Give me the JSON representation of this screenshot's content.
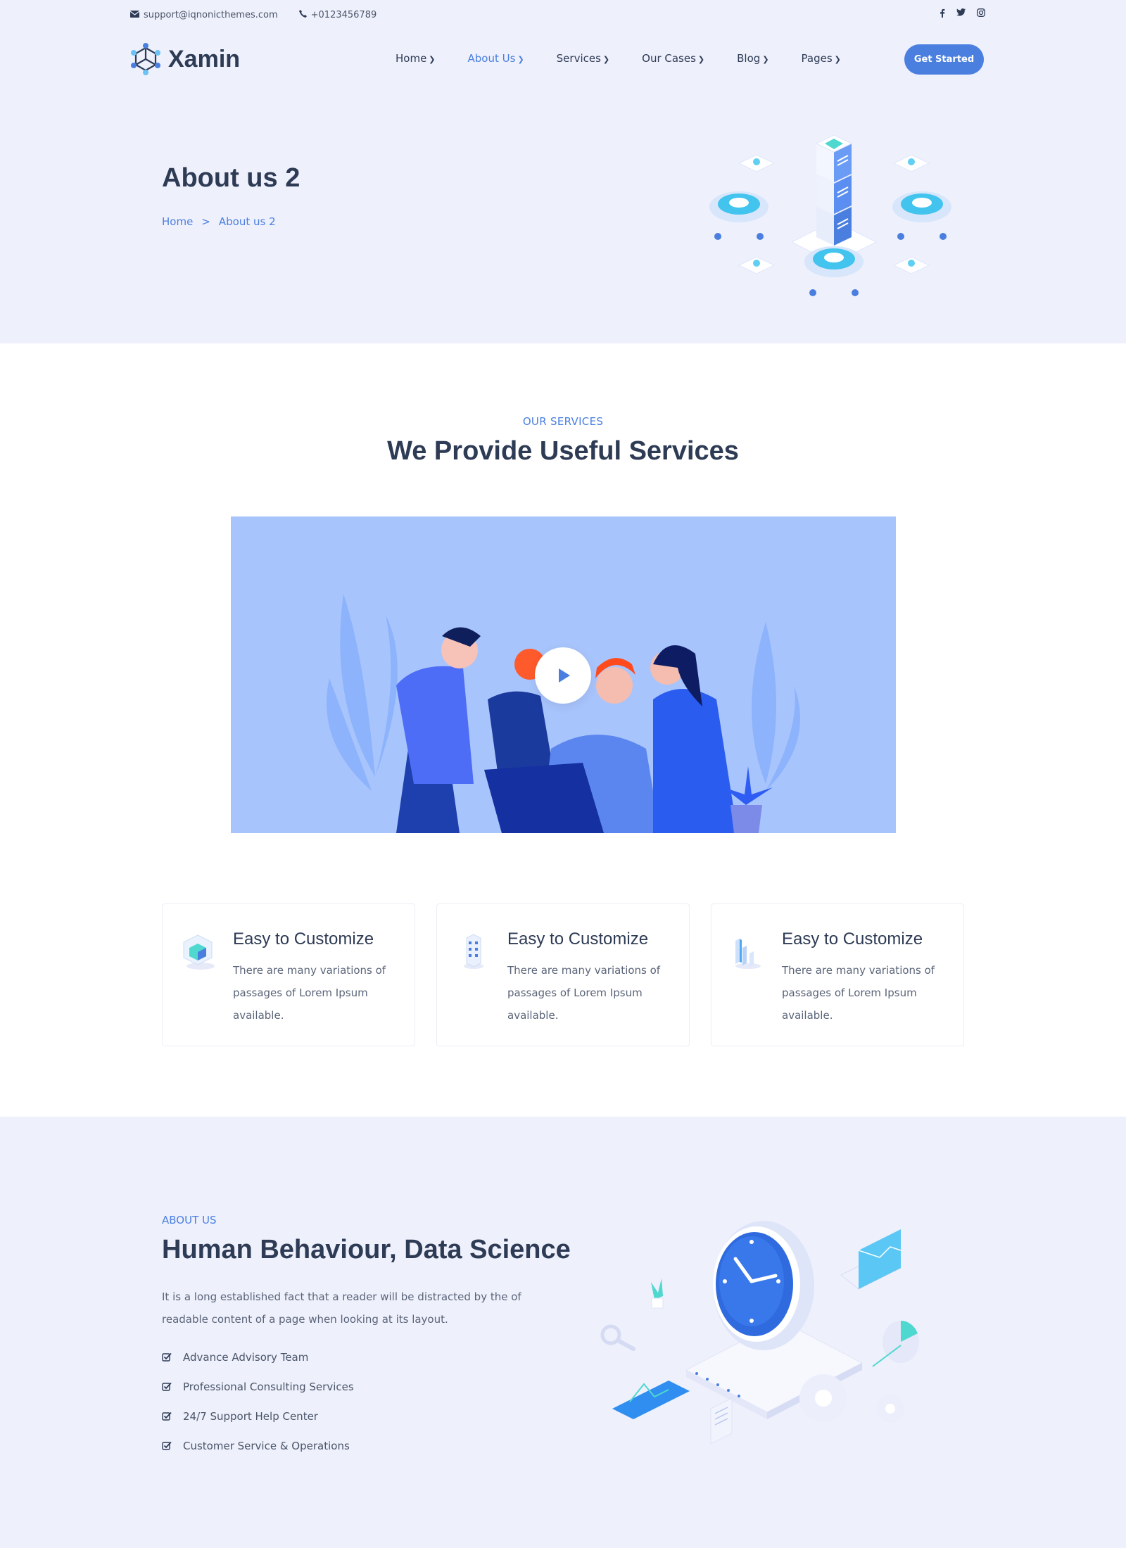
{
  "topbar": {
    "email": "support@iqnonicthemes.com",
    "phone": "+0123456789",
    "social": [
      "facebook-icon",
      "twitter-icon",
      "instagram-icon"
    ]
  },
  "header": {
    "brand": "Xamin",
    "nav": [
      {
        "label": "Home",
        "active": false
      },
      {
        "label": "About Us",
        "active": true
      },
      {
        "label": "Services",
        "active": false
      },
      {
        "label": "Our Cases",
        "active": false
      },
      {
        "label": "Blog",
        "active": false
      },
      {
        "label": "Pages",
        "active": false
      }
    ],
    "cta": "Get Started"
  },
  "hero": {
    "title": "About us 2",
    "breadcrumb": {
      "home": "Home",
      "separator": ">",
      "current": "About us 2"
    }
  },
  "services": {
    "eyebrow": "OUR SERVICES",
    "title": "We Provide Useful Services",
    "video": {
      "play_icon": "play-icon"
    },
    "cards": [
      {
        "icon": "cube-icon",
        "title": "Easy to Customize",
        "text": "There are many variations of passages of Lorem Ipsum available."
      },
      {
        "icon": "building-icon",
        "title": "Easy to Customize",
        "text": "There are many variations of passages of Lorem Ipsum available."
      },
      {
        "icon": "bar-chart-icon",
        "title": "Easy to Customize",
        "text": "There are many variations of passages of Lorem Ipsum available."
      }
    ]
  },
  "about": {
    "eyebrow": "ABOUT US",
    "title": "Human Behaviour, Data Science",
    "lead": "It is a long established fact that a reader will be distracted by the of readable content of a page when looking at its layout.",
    "items": [
      "Advance Advisory Team",
      "Professional Consulting Services",
      "24/7 Support Help Center",
      "Customer Service & Operations"
    ]
  },
  "colors": {
    "accent": "#4a7fe0",
    "heading": "#2e3b55",
    "section_bg": "#eef0fc",
    "video_bg": "#a8c4fc"
  }
}
